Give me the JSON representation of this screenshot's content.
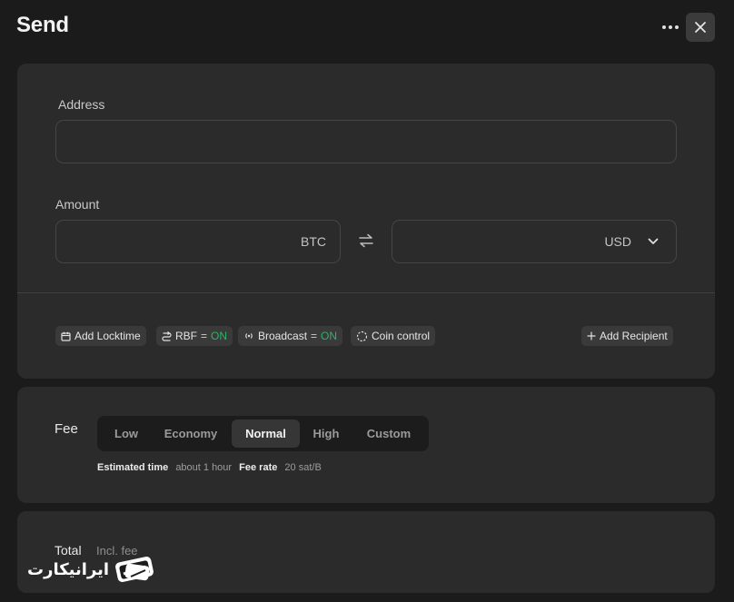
{
  "header": {
    "title": "Send",
    "more_icon": "more-horizontal-icon",
    "close_icon": "close-icon"
  },
  "address": {
    "label": "Address",
    "value": "",
    "placeholder": ""
  },
  "amount": {
    "label": "Amount",
    "btc": {
      "value": "",
      "unit": "BTC"
    },
    "swap_icon": "swap-arrows-icon",
    "fiat": {
      "value": "",
      "unit": "USD",
      "dropdown_icon": "chevron-down-icon"
    }
  },
  "options": {
    "locktime": {
      "label": "Add Locktime",
      "icon": "calendar-icon"
    },
    "rbf": {
      "label": "RBF",
      "eq": "=",
      "state": "ON",
      "icon": "rbf-icon"
    },
    "broadcast": {
      "label": "Broadcast",
      "eq": "=",
      "state": "ON",
      "icon": "broadcast-icon"
    },
    "coin_control": {
      "label": "Coin control",
      "icon": "coin-control-icon"
    },
    "add_recipient": {
      "label": "Add Recipient",
      "icon": "plus-icon"
    }
  },
  "fee": {
    "label": "Fee",
    "options": [
      "Low",
      "Economy",
      "Normal",
      "High",
      "Custom"
    ],
    "selected": "Normal",
    "estimated_time_label": "Estimated time",
    "estimated_time_value": "about 1 hour",
    "fee_rate_label": "Fee rate",
    "fee_rate_value": "20 sat/B"
  },
  "total": {
    "label": "Total",
    "note": "Incl. fee"
  },
  "watermark": {
    "text": "ایرانیکارت"
  },
  "colors": {
    "on": "#2fb267",
    "background": "#1b1b1c",
    "card": "#2b2b2c"
  }
}
